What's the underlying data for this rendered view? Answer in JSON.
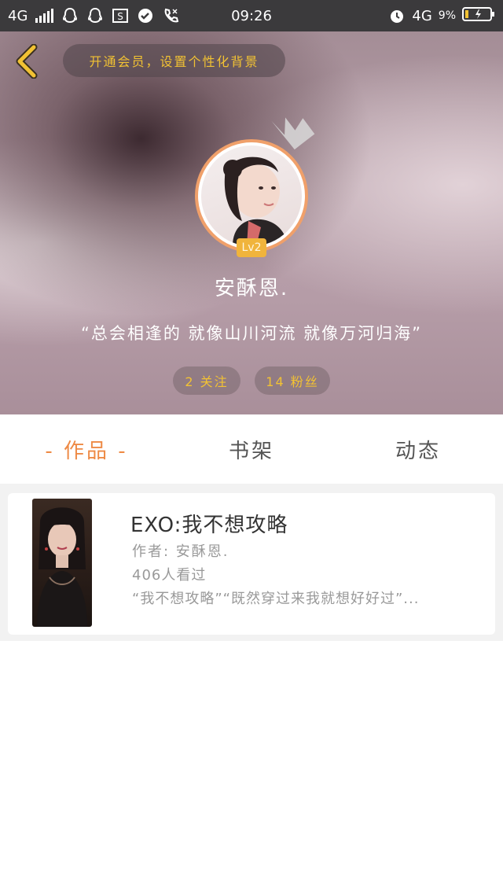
{
  "status_bar": {
    "network_left": "4G",
    "time": "09:26",
    "network_right": "4G",
    "battery": "9%"
  },
  "header": {
    "vip_banner": "开通会员，设置个性化背景",
    "level_badge": "Lv2",
    "username": "安酥恩.",
    "signature": "“总会相逢的 就像山川河流 就像万河归海”",
    "following": "2 关注",
    "followers": "14 粉丝"
  },
  "tabs": [
    {
      "label": "- 作品 -",
      "active": true
    },
    {
      "label": "书架",
      "active": false
    },
    {
      "label": "动态",
      "active": false
    }
  ],
  "works": [
    {
      "title": "EXO:我不想攻略",
      "author": "作者: 安酥恩.",
      "views": "406人看过",
      "excerpt": "“我不想攻略”“既然穿过来我就想好好过”..."
    }
  ],
  "colors": {
    "accent_orange": "#ee8a45",
    "gold": "#f2c233",
    "status_bar": "#3b3a3c"
  }
}
